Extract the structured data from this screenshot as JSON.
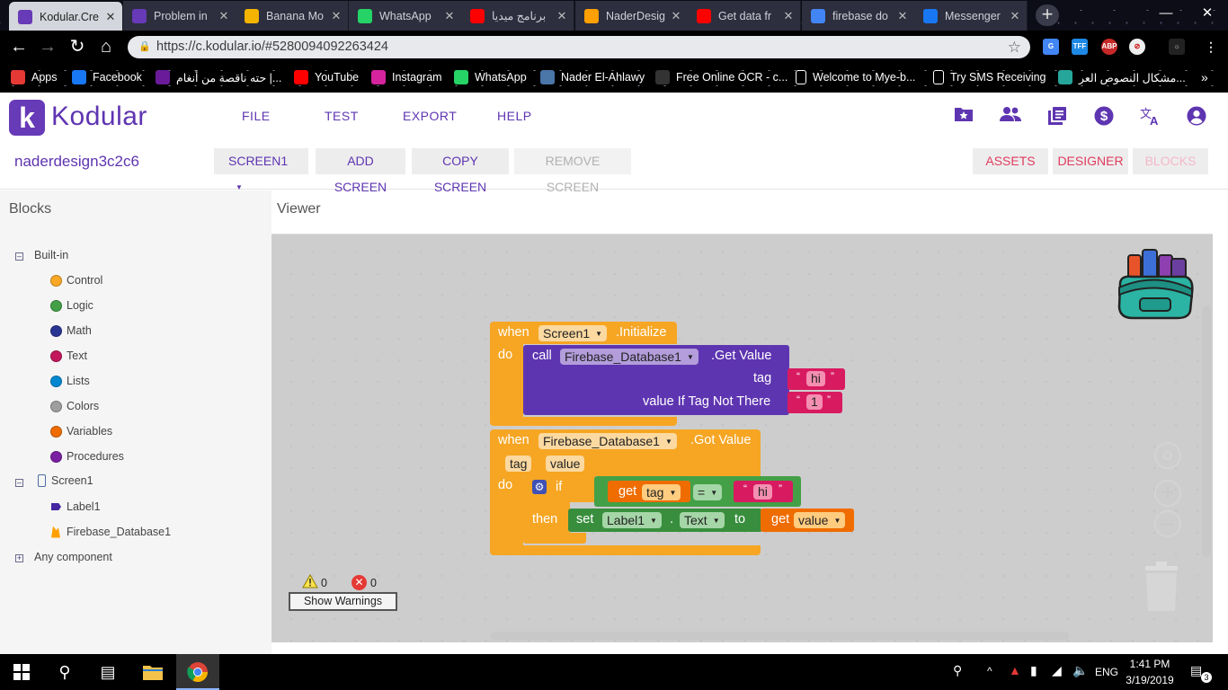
{
  "browser": {
    "tabs": [
      {
        "label": "Kodular.Cre",
        "favicon": "kodular-icon",
        "color": "#673ab7",
        "active": true
      },
      {
        "label": "Problem in",
        "favicon": "kodular-icon",
        "color": "#673ab7"
      },
      {
        "label": "Banana Mo",
        "favicon": "banana-icon",
        "color": "#f4b400"
      },
      {
        "label": "WhatsApp",
        "favicon": "whatsapp-icon",
        "color": "#25d366"
      },
      {
        "label": "برنامج ميديا",
        "favicon": "youtube-icon",
        "color": "#ff0000"
      },
      {
        "label": "NaderDesig",
        "favicon": "firebase-icon",
        "color": "#ffa000"
      },
      {
        "label": "Get data fr",
        "favicon": "youtube-icon",
        "color": "#ff0000"
      },
      {
        "label": "firebase do",
        "favicon": "google-icon",
        "color": "#4285f4"
      },
      {
        "label": "Messenger",
        "favicon": "facebook-icon",
        "color": "#1877f2"
      }
    ],
    "url": "https://c.kodular.io/#5280094092263424",
    "bookmarks": [
      {
        "label": "Apps",
        "icon": "apps-grid-icon",
        "color": "#e53935"
      },
      {
        "label": "Facebook",
        "icon": "facebook-icon",
        "color": "#1877f2"
      },
      {
        "label": "حته ناقصة من أنغام |...",
        "icon": "music-icon",
        "color": "#6a1b9a"
      },
      {
        "label": "YouTube",
        "icon": "youtube-icon",
        "color": "#ff0000"
      },
      {
        "label": "Instagram",
        "icon": "instagram-icon",
        "color": "#d6249f"
      },
      {
        "label": "WhatsApp",
        "icon": "whatsapp-icon",
        "color": "#25d366"
      },
      {
        "label": "Nader El-Ahlawy",
        "icon": "vk-icon",
        "color": "#4a76a8"
      },
      {
        "label": "Free Online OCR - c...",
        "icon": "ocr-icon",
        "color": "#333333"
      },
      {
        "label": "Welcome to Mye-b...",
        "icon": "page-icon",
        "color": "#ffffff"
      },
      {
        "label": "Try SMS Receiving",
        "icon": "sms-icon",
        "color": "#ffffff"
      },
      {
        "label": "مشكال النصوص العر...",
        "icon": "text-tool-icon",
        "color": "#26a69a"
      }
    ]
  },
  "app": {
    "logo_letter": "k",
    "logo_text": "Kodular",
    "menu": [
      "FILE",
      "TEST",
      "EXPORT",
      "HELP"
    ],
    "project_name": "naderdesign3c2c6",
    "screen_select": "SCREEN1",
    "add_screen": "ADD SCREEN",
    "copy_screen": "COPY SCREEN",
    "remove_screen": "REMOVE SCREEN",
    "assets": "ASSETS",
    "designer": "DESIGNER",
    "blocks_btn": "BLOCKS",
    "accent": "#5e35b1"
  },
  "left": {
    "title": "Blocks",
    "builtin": "Built-in",
    "categories": [
      {
        "label": "Control",
        "color": "#f9a825"
      },
      {
        "label": "Logic",
        "color": "#43a047"
      },
      {
        "label": "Math",
        "color": "#283593"
      },
      {
        "label": "Text",
        "color": "#c2185b"
      },
      {
        "label": "Lists",
        "color": "#0288d1"
      },
      {
        "label": "Colors",
        "color": "#9e9e9e"
      },
      {
        "label": "Variables",
        "color": "#ef6c00"
      },
      {
        "label": "Procedures",
        "color": "#7b1fa2"
      }
    ],
    "screen": "Screen1",
    "components": [
      "Label1",
      "Firebase_Database1"
    ],
    "any": "Any component"
  },
  "viewer": {
    "title": "Viewer",
    "warnings_count": "0",
    "errors_count": "0",
    "show_warnings": "Show Warnings"
  },
  "blocks": {
    "b1": {
      "when": "when",
      "component": "Screen1",
      "event": ".Initialize",
      "do": "do",
      "call": "call",
      "db": "Firebase_Database1",
      "method": ".Get Value",
      "tag": "tag",
      "tag_value": "hi",
      "vitnt": "value If Tag Not There",
      "vitnt_value": "1",
      "quote_open": "“",
      "quote_close": "”"
    },
    "b2": {
      "when": "when",
      "component": "Firebase_Database1",
      "event": ".Got Value",
      "param1": "tag",
      "param2": "value",
      "do": "do",
      "if": "if",
      "then": "then",
      "get": "get",
      "get_var": "tag",
      "op": "=",
      "cmp": "hi",
      "set": "set",
      "set_comp": "Label1",
      "dot": ".",
      "prop": "Text",
      "to": "to",
      "get2": "get",
      "get2_var": "value"
    }
  },
  "taskbar": {
    "time": "1:41 PM",
    "date": "3/19/2019",
    "lang": "ENG",
    "notif_count": "3"
  }
}
